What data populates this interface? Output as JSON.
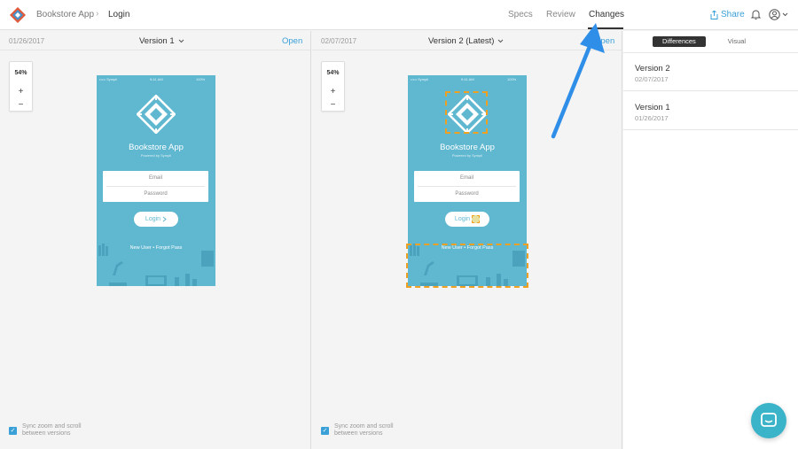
{
  "app": {
    "name": "Bookstore App",
    "page": "Login",
    "separator": "›"
  },
  "nav": {
    "tabs": [
      "Specs",
      "Review",
      "Changes"
    ],
    "active": "Changes"
  },
  "header_actions": {
    "share_label": "Share"
  },
  "left_panel": {
    "date": "01/26/2017",
    "version_label": "Version 1",
    "open_label": "Open",
    "zoom": "54%"
  },
  "right_panel": {
    "date": "02/07/2017",
    "version_label": "Version 2 (Latest)",
    "open_label": "Open",
    "zoom": "54%"
  },
  "zoom_controls": {
    "plus": "+",
    "minus": "−"
  },
  "mockup": {
    "status_left": "••••• Sympli",
    "status_center": "9:41 AM",
    "status_right": "100%",
    "title": "Bookstore App",
    "subtitle": "Powered by Sympli",
    "email_placeholder": "Email",
    "password_placeholder": "Password",
    "login_label": "Login",
    "links": "New User • Forgot Pass"
  },
  "sync": {
    "label_line1": "Sync zoom and scroll",
    "label_line2": "between versions",
    "checked": true
  },
  "sidebar": {
    "modes": [
      "Differences",
      "Visual"
    ],
    "active_mode": "Differences",
    "versions": [
      {
        "name": "Version 2",
        "date": "02/07/2017"
      },
      {
        "name": "Version 1",
        "date": "01/26/2017"
      }
    ]
  },
  "colors": {
    "accent": "#3aa0d8",
    "phone_bg": "#5fb7d0",
    "diff_highlight": "#f0a020",
    "chat_bg": "#3bb3c8",
    "arrow": "#2f8ee8"
  }
}
